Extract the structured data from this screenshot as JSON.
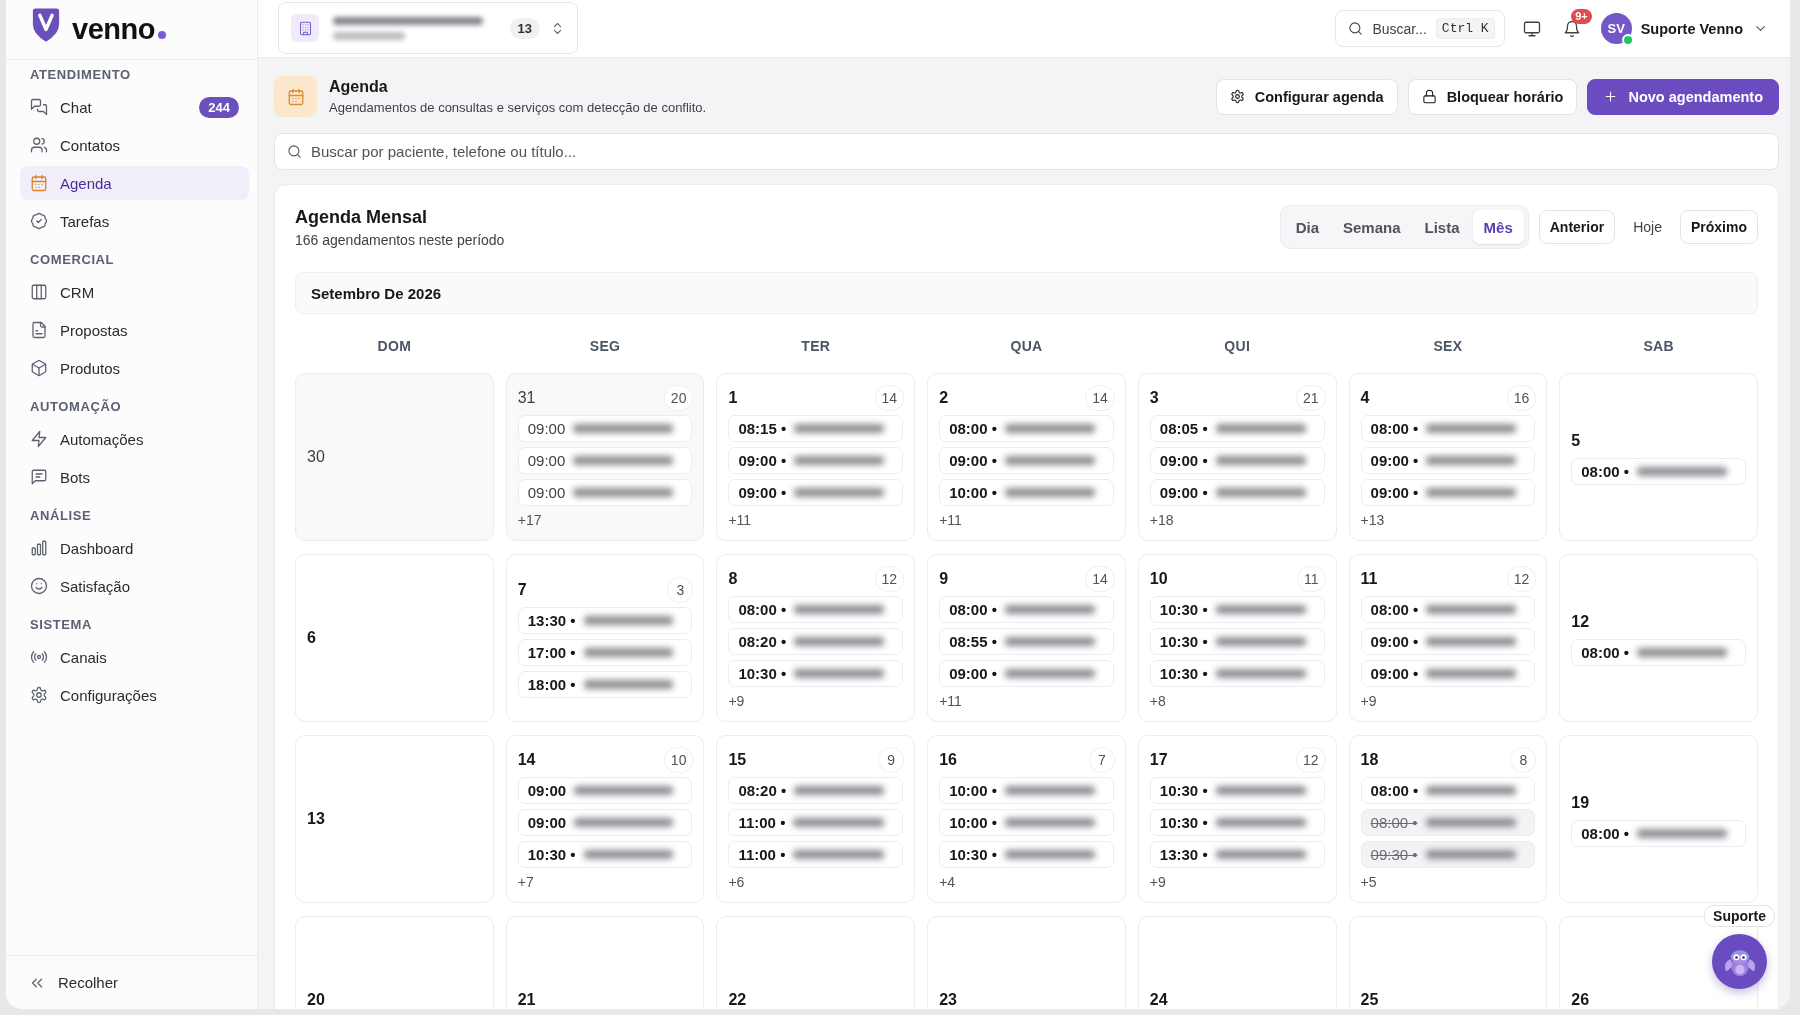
{
  "brand": {
    "name": "venno"
  },
  "sidebar": {
    "sections": [
      {
        "title": "ATENDIMENTO",
        "items": [
          {
            "label": "Chat",
            "kind": "chat",
            "badge": "244",
            "selected": false
          },
          {
            "label": "Contatos",
            "kind": "contacts",
            "selected": false
          },
          {
            "label": "Agenda",
            "kind": "calendar",
            "selected": true
          },
          {
            "label": "Tarefas",
            "kind": "tasks",
            "selected": false
          }
        ]
      },
      {
        "title": "COMERCIAL",
        "items": [
          {
            "label": "CRM",
            "kind": "board",
            "selected": false
          },
          {
            "label": "Propostas",
            "kind": "document",
            "selected": false
          },
          {
            "label": "Produtos",
            "kind": "box",
            "selected": false
          }
        ]
      },
      {
        "title": "AUTOMAÇÃO",
        "items": [
          {
            "label": "Automações",
            "kind": "bolt",
            "selected": false
          },
          {
            "label": "Bots",
            "kind": "message",
            "selected": false
          }
        ]
      },
      {
        "title": "ANÁLISE",
        "items": [
          {
            "label": "Dashboard",
            "kind": "chart",
            "selected": false
          },
          {
            "label": "Satisfação",
            "kind": "smile",
            "selected": false
          }
        ]
      },
      {
        "title": "SISTEMA",
        "items": [
          {
            "label": "Canais",
            "kind": "signal",
            "selected": false
          },
          {
            "label": "Configurações",
            "kind": "settings",
            "selected": false
          }
        ]
      }
    ],
    "collapse": {
      "label": "Recolher"
    }
  },
  "topbar": {
    "workspace": {
      "count": "13"
    },
    "search": {
      "label": "Buscar...",
      "shortcut": "Ctrl K"
    },
    "notifications": {
      "badge": "9+"
    },
    "user": {
      "initials": "SV",
      "name": "Suporte Venno",
      "online": true
    }
  },
  "page_header": {
    "title": "Agenda",
    "subtitle": "Agendamentos de consultas e serviços com detecção de conflito.",
    "actions": [
      {
        "label": "Configurar agenda",
        "kind": "settings"
      },
      {
        "label": "Bloquear horário",
        "kind": "lock"
      },
      {
        "label": "Novo agendamento",
        "kind": "create"
      }
    ]
  },
  "search": {
    "placeholder": "Buscar por paciente, telefone ou título..."
  },
  "calendar": {
    "title": "Agenda Mensal",
    "subtitle": "166 agendamentos neste período",
    "views": [
      {
        "label": "Dia",
        "selected": false
      },
      {
        "label": "Semana",
        "selected": false
      },
      {
        "label": "Lista",
        "selected": false
      },
      {
        "label": "Mês",
        "selected": true
      }
    ],
    "nav": [
      {
        "label": "Anterior",
        "kind": "outline"
      },
      {
        "label": "Hoje",
        "kind": "plain"
      },
      {
        "label": "Próximo",
        "kind": "outline"
      }
    ],
    "month_label": "Setembro De 2026",
    "weekdays": [
      "DOM",
      "SEG",
      "TER",
      "QUA",
      "QUI",
      "SEX",
      "SAB"
    ],
    "weeks": [
      {
        "days": [
          {
            "day": "30",
            "outside_month": true
          },
          {
            "day": "31",
            "outside_month": true,
            "count": "20",
            "events": [
              {
                "time": "09:00",
                "cancelled": false
              },
              {
                "time": "09:00",
                "cancelled": false
              },
              {
                "time": "09:00",
                "cancelled": false
              }
            ],
            "more": "+17"
          },
          {
            "day": "1",
            "outside_month": false,
            "count": "14",
            "events": [
              {
                "time": "08:15 •",
                "cancelled": false
              },
              {
                "time": "09:00 •",
                "cancelled": false
              },
              {
                "time": "09:00 •",
                "cancelled": false
              }
            ],
            "more": "+11"
          },
          {
            "day": "2",
            "outside_month": false,
            "count": "14",
            "events": [
              {
                "time": "08:00 •",
                "cancelled": false
              },
              {
                "time": "09:00 •",
                "cancelled": false
              },
              {
                "time": "10:00 •",
                "cancelled": false
              }
            ],
            "more": "+11"
          },
          {
            "day": "3",
            "outside_month": false,
            "count": "21",
            "events": [
              {
                "time": "08:05 •",
                "cancelled": false
              },
              {
                "time": "09:00 •",
                "cancelled": false
              },
              {
                "time": "09:00 •",
                "cancelled": false
              }
            ],
            "more": "+18"
          },
          {
            "day": "4",
            "outside_month": false,
            "count": "16",
            "events": [
              {
                "time": "08:00 •",
                "cancelled": false
              },
              {
                "time": "09:00 •",
                "cancelled": false
              },
              {
                "time": "09:00 •",
                "cancelled": false
              }
            ],
            "more": "+13"
          },
          {
            "day": "5",
            "outside_month": false,
            "events": [
              {
                "time": "08:00 •",
                "cancelled": false
              }
            ]
          }
        ]
      },
      {
        "days": [
          {
            "day": "6",
            "outside_month": false
          },
          {
            "day": "7",
            "outside_month": false,
            "count": "3",
            "events": [
              {
                "time": "13:30 •",
                "cancelled": false
              },
              {
                "time": "17:00 •",
                "cancelled": false
              },
              {
                "time": "18:00 •",
                "cancelled": false
              }
            ]
          },
          {
            "day": "8",
            "outside_month": false,
            "count": "12",
            "events": [
              {
                "time": "08:00 •",
                "cancelled": false
              },
              {
                "time": "08:20 •",
                "cancelled": false
              },
              {
                "time": "10:30 •",
                "cancelled": false
              }
            ],
            "more": "+9"
          },
          {
            "day": "9",
            "outside_month": false,
            "count": "14",
            "events": [
              {
                "time": "08:00 •",
                "cancelled": false
              },
              {
                "time": "08:55 •",
                "cancelled": false
              },
              {
                "time": "09:00 •",
                "cancelled": false
              }
            ],
            "more": "+11"
          },
          {
            "day": "10",
            "outside_month": false,
            "count": "11",
            "events": [
              {
                "time": "10:30 •",
                "cancelled": false
              },
              {
                "time": "10:30 •",
                "cancelled": false
              },
              {
                "time": "10:30 •",
                "cancelled": false
              }
            ],
            "more": "+8"
          },
          {
            "day": "11",
            "outside_month": false,
            "count": "12",
            "events": [
              {
                "time": "08:00 •",
                "cancelled": false
              },
              {
                "time": "09:00 •",
                "cancelled": false
              },
              {
                "time": "09:00 •",
                "cancelled": false
              }
            ],
            "more": "+9"
          },
          {
            "day": "12",
            "outside_month": false,
            "events": [
              {
                "time": "08:00 •",
                "cancelled": false
              }
            ]
          }
        ]
      },
      {
        "days": [
          {
            "day": "13",
            "outside_month": false
          },
          {
            "day": "14",
            "outside_month": false,
            "count": "10",
            "events": [
              {
                "time": "09:00",
                "cancelled": false
              },
              {
                "time": "09:00",
                "cancelled": false
              },
              {
                "time": "10:30 •",
                "cancelled": false
              }
            ],
            "more": "+7"
          },
          {
            "day": "15",
            "outside_month": false,
            "count": "9",
            "events": [
              {
                "time": "08:20 •",
                "cancelled": false
              },
              {
                "time": "11:00 •",
                "cancelled": false
              },
              {
                "time": "11:00 •",
                "cancelled": false
              }
            ],
            "more": "+6"
          },
          {
            "day": "16",
            "outside_month": false,
            "count": "7",
            "events": [
              {
                "time": "10:00 •",
                "cancelled": false
              },
              {
                "time": "10:00 •",
                "cancelled": false
              },
              {
                "time": "10:30 •",
                "cancelled": false
              }
            ],
            "more": "+4"
          },
          {
            "day": "17",
            "outside_month": false,
            "count": "12",
            "events": [
              {
                "time": "10:30 •",
                "cancelled": false
              },
              {
                "time": "10:30 •",
                "cancelled": false
              },
              {
                "time": "13:30 •",
                "cancelled": false
              }
            ],
            "more": "+9"
          },
          {
            "day": "18",
            "outside_month": false,
            "count": "8",
            "events": [
              {
                "time": "08:00 •",
                "cancelled": false
              },
              {
                "time": "08:00 •",
                "cancelled": true
              },
              {
                "time": "09:30 •",
                "cancelled": true
              }
            ],
            "more": "+5"
          },
          {
            "day": "19",
            "outside_month": false,
            "events": [
              {
                "time": "08:00 •",
                "cancelled": false
              }
            ]
          }
        ]
      },
      {
        "days": [
          {
            "day": "20",
            "outside_month": false
          },
          {
            "day": "21",
            "outside_month": false
          },
          {
            "day": "22",
            "outside_month": false
          },
          {
            "day": "23",
            "outside_month": false
          },
          {
            "day": "24",
            "outside_month": false
          },
          {
            "day": "25",
            "outside_month": false
          },
          {
            "day": "26",
            "outside_month": false
          }
        ]
      }
    ]
  },
  "support": {
    "label": "Suporte"
  }
}
